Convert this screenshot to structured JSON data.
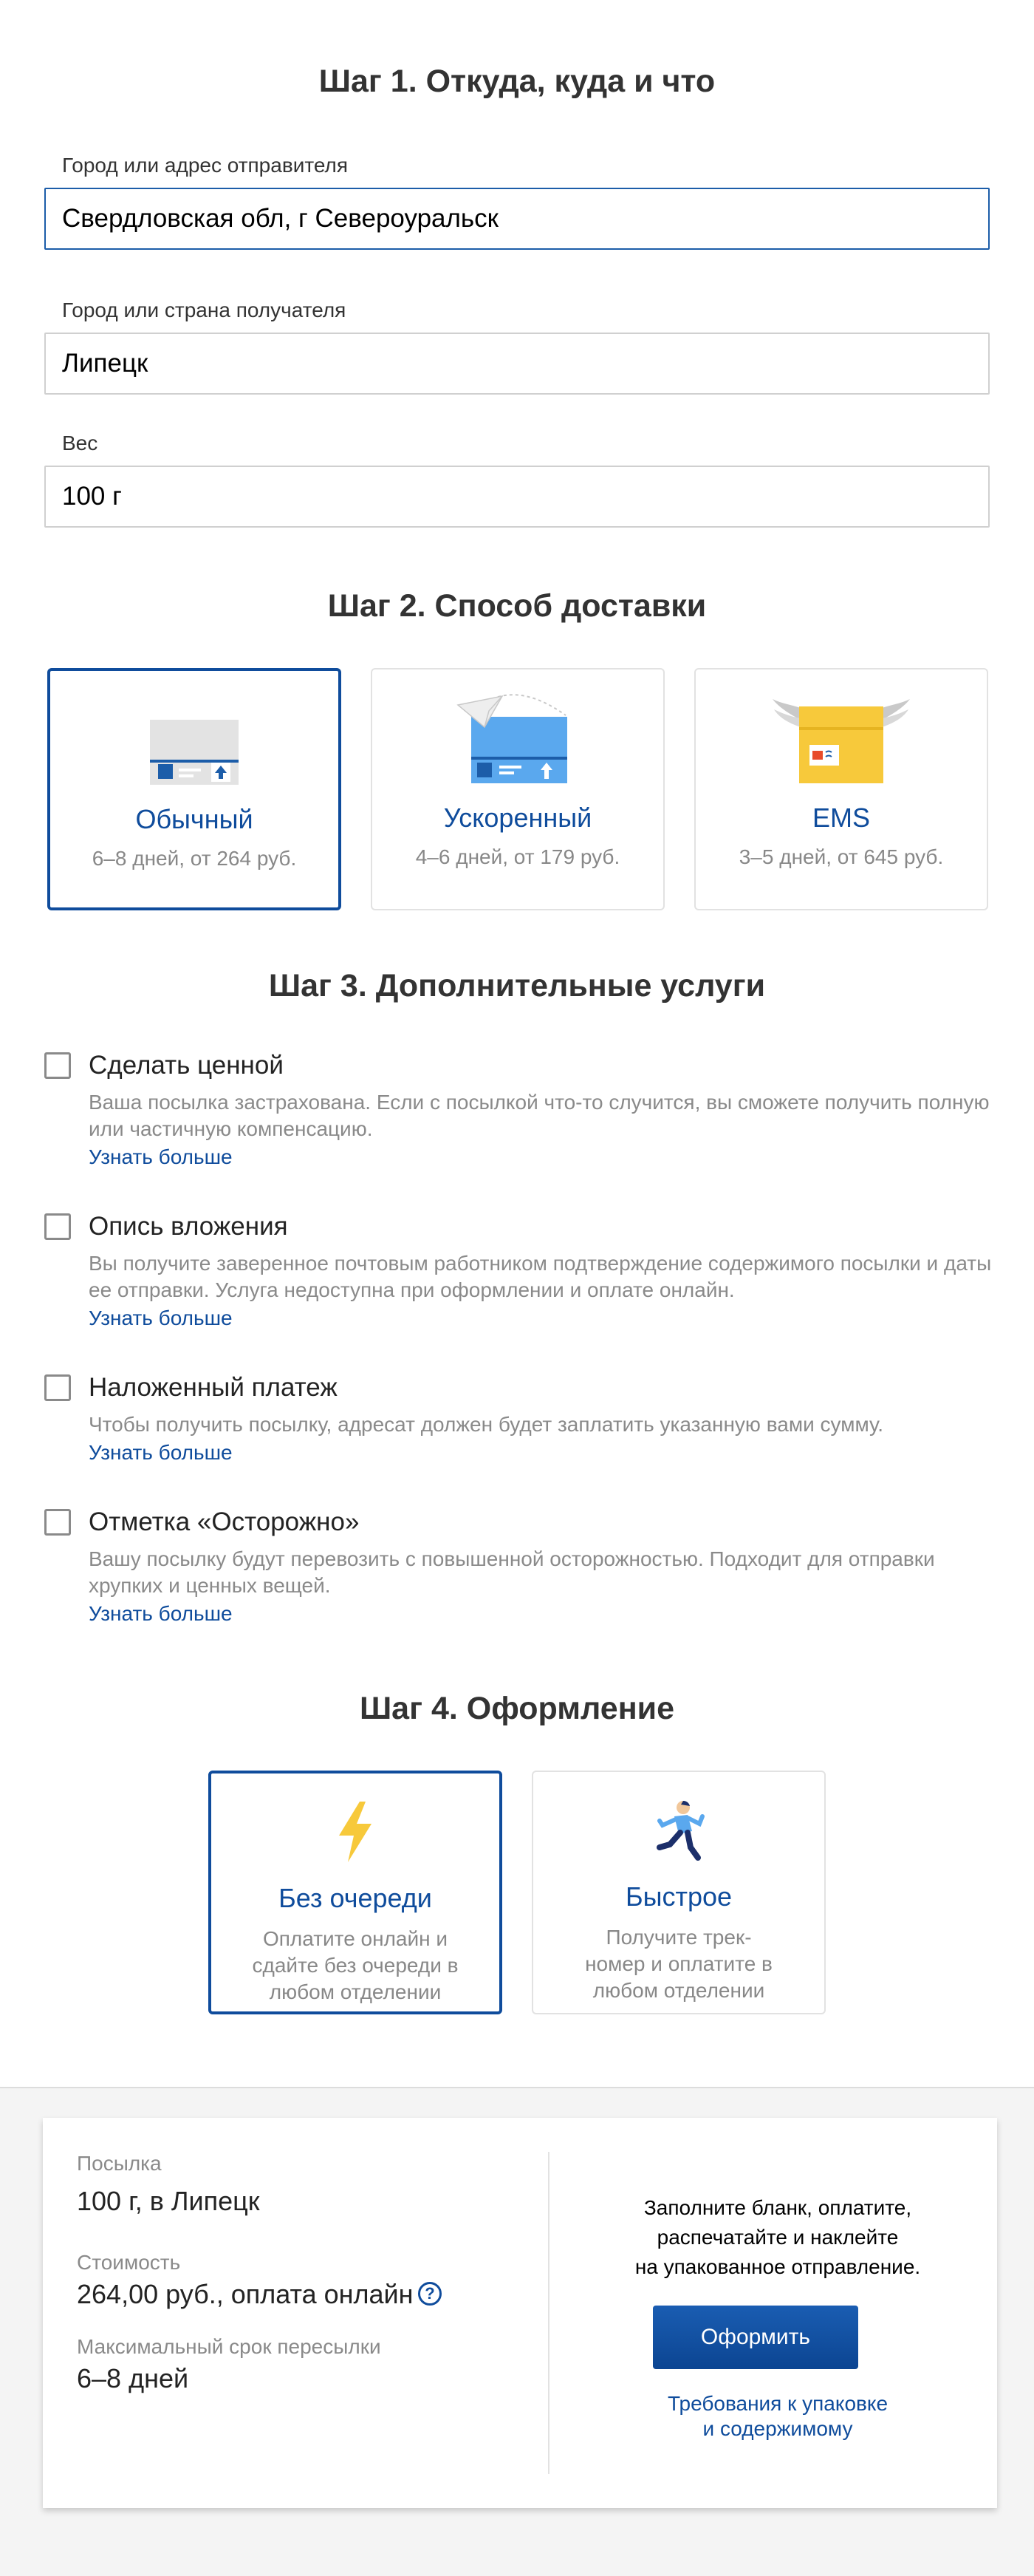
{
  "step1": {
    "title": "Шаг 1. Откуда, куда и что",
    "sender_label": "Город или адрес отправителя",
    "sender_value": "Свердловская обл, г Североуральск",
    "recipient_label": "Город или страна получателя",
    "recipient_value": "Липецк",
    "weight_label": "Вес",
    "weight_value": "100 г"
  },
  "step2": {
    "title": "Шаг 2. Способ доставки",
    "options": [
      {
        "title": "Обычный",
        "subtitle": "6–8 дней, от 264 руб.",
        "icon": "envelope-icon",
        "selected": true
      },
      {
        "title": "Ускоренный",
        "subtitle": "4–6 дней, от 179 руб.",
        "icon": "paper-plane-envelope-icon",
        "selected": false
      },
      {
        "title": "EMS",
        "subtitle": "3–5 дней, от 645 руб.",
        "icon": "winged-package-icon",
        "selected": false
      }
    ]
  },
  "step3": {
    "title": "Шаг 3. Дополнительные услуги",
    "services": [
      {
        "name": "Сделать ценной",
        "desc": "Ваша посылка застрахована. Если с посылкой что-то случится, вы сможете получить полную или частичную компенсацию.",
        "more": "Узнать больше",
        "checked": false
      },
      {
        "name": "Опись вложения",
        "desc": "Вы получите заверенное почтовым работником подтверждение содержимого посылки и даты ее отправки. Услуга недоступна при оформлении и оплате онлайн.",
        "more": "Узнать больше",
        "checked": false
      },
      {
        "name": "Наложенный платеж",
        "desc": "Чтобы получить посылку, адресат должен будет заплатить указанную вами сумму.",
        "more": "Узнать больше",
        "checked": false
      },
      {
        "name": "Отметка «Осторожно»",
        "desc": "Вашу посылку будут перевозить с повышенной осторожностью. Подходит для отправки хрупких и ценных вещей.",
        "more": "Узнать больше",
        "checked": false
      }
    ]
  },
  "step4": {
    "title": "Шаг 4. Оформление",
    "options": [
      {
        "title": "Без очереди",
        "subtitle": "Оплатите онлайн и сдайте без очереди в любом отделении",
        "icon": "lightning-icon",
        "selected": true
      },
      {
        "title": "Быстрое",
        "subtitle": "Получите трек-номер и оплатите в любом отделении",
        "icon": "runner-icon",
        "selected": false
      }
    ]
  },
  "summary": {
    "parcel_label": "Посылка",
    "parcel_value": "100 г, в Липецк",
    "cost_label": "Стоимость",
    "cost_value": "264,00 руб., оплата онлайн",
    "help_glyph": "?",
    "term_label": "Максимальный срок пересылки",
    "term_value": "6–8 дней",
    "instruction_lines": [
      "Заполните бланк, оплатите,",
      "распечатайте и наклейте",
      "на упакованное отправление."
    ],
    "submit_label": "Оформить",
    "requirements_lines": [
      "Требования к упаковке",
      "и содержимому"
    ]
  },
  "colors": {
    "accent": "#0f4c9c",
    "selected_border": "#0f4c9c",
    "muted_text": "#8a8a8a",
    "footer_bg": "#f4f4f4",
    "ems_yellow": "#f7c93b",
    "fast_blue": "#5aa8ee"
  }
}
